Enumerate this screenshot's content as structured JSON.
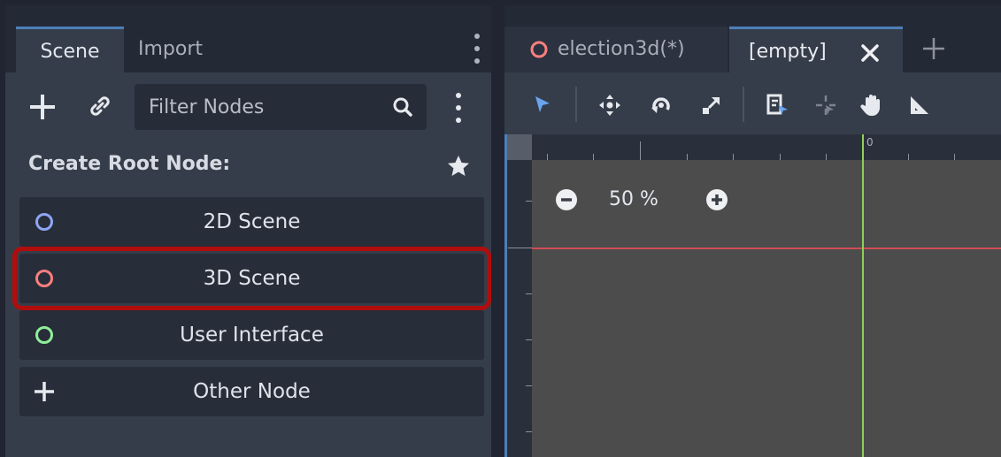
{
  "scene_dock": {
    "tabs": [
      {
        "label": "Scene",
        "active": true
      },
      {
        "label": "Import",
        "active": false
      }
    ],
    "filter": {
      "placeholder": "Filter Nodes",
      "value": ""
    },
    "create_root_label": "Create Root Node:",
    "root_nodes": [
      {
        "label": "2D Scene",
        "icon": "circle-outline-icon",
        "color": "#8da5f3"
      },
      {
        "label": "3D Scene",
        "icon": "circle-outline-icon",
        "color": "#fc7f7f",
        "highlighted": true
      },
      {
        "label": "User Interface",
        "icon": "circle-outline-icon",
        "color": "#8eef97"
      },
      {
        "label": "Other Node",
        "icon": "plus-icon",
        "color": "#e6e9ee"
      }
    ],
    "highlight_color": "#b00d0d"
  },
  "editor": {
    "tabs": [
      {
        "label": "election3d(*)",
        "icon": "circle-outline-icon",
        "color": "#fc7f7f"
      },
      {
        "label": "[empty]",
        "active": true
      }
    ],
    "zoom_label": "50 %",
    "ruler_origin_label": "0",
    "accent_color": "#4d7fb9"
  }
}
